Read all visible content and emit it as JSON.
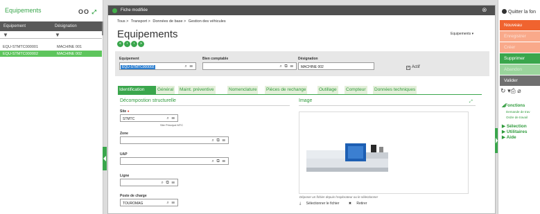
{
  "left": {
    "title": "Equipements",
    "tools": [
      "O",
      "O"
    ],
    "col_equipement": "Equipement",
    "col_designation": "Désignation",
    "rows": [
      {
        "code": "EQU-STMTC000001",
        "designation": "MACHINE 001"
      },
      {
        "code": "EQU-STMTC000002",
        "designation": "MACHINE 002"
      }
    ]
  },
  "window": {
    "title": "Fiche modifiée",
    "close": "⊗"
  },
  "breadcrumb": [
    "Tous >",
    "Transport >",
    "Données de base >",
    "Gestion des véhicules"
  ],
  "page": {
    "title": "Equipements",
    "favorites": "Equipements ▾"
  },
  "header": {
    "equipement_label": "Equipement",
    "equipement_value": "EQU-STMTC000002",
    "bien_label": "Bien comptable",
    "bien_value": "",
    "designation_label": "Désignation",
    "designation_value": "MACHINE 002",
    "actif_label": "Actif"
  },
  "tabs": [
    "Identification",
    "Général",
    "Maint. préventive",
    "Nomenclature",
    "Pièces de rechange",
    "Outillage",
    "Compteur",
    "Données techniques"
  ],
  "decomp": {
    "title": "Décompostion structurelle",
    "site_label": "Site",
    "site_value": "STMTC",
    "site_hint": "Site Principal MTC",
    "zone_label": "Zone",
    "uap_label": "UAP",
    "ligne_label": "Ligne",
    "poste_label": "Poste de charge",
    "poste_value": "TOUROMAG"
  },
  "image": {
    "title": "Image",
    "drop_text": "Déposer un fichier depuis l'explorateur ou le sélectionner",
    "select_label": "Sélectionner le fichier",
    "remove_label": "Retirer"
  },
  "right": {
    "quit_label": "Quitter la fon",
    "actions": [
      "Nouveau",
      "Enregistrer",
      "Créer",
      "Supprimer",
      "Abandon",
      "Valider"
    ],
    "functions_title": "Fonctions",
    "functions": [
      "Demande de trav",
      "Ordre de travail"
    ],
    "groups": [
      "Sélection",
      "Utilitaires",
      "Aide"
    ]
  },
  "colors": {
    "accent_green": "#3aa64c",
    "nouveau_orange": "#f0632f",
    "dark_bar": "#4f4f4f"
  }
}
